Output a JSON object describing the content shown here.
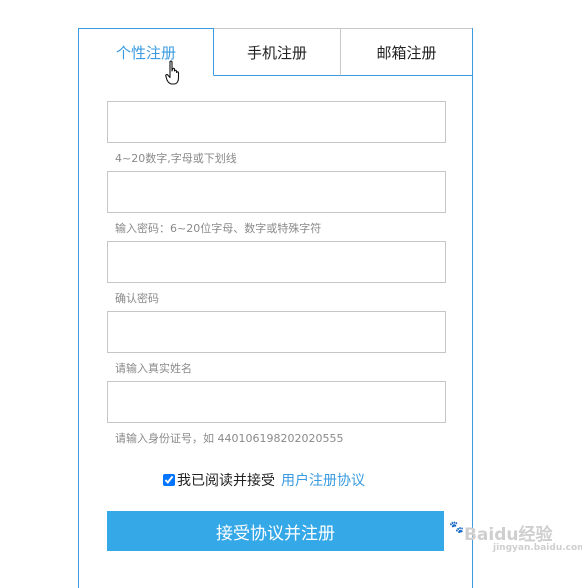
{
  "tabs": [
    {
      "label": "个性注册",
      "active": true
    },
    {
      "label": "手机注册",
      "active": false
    },
    {
      "label": "邮箱注册",
      "active": false
    }
  ],
  "fields": [
    {
      "value": "",
      "hint": "4~20数字,字母或下划线"
    },
    {
      "value": "",
      "hint": "输入密码：6~20位字母、数字或特殊字符"
    },
    {
      "value": "",
      "hint": "确认密码"
    },
    {
      "value": "",
      "hint": "请输入真实姓名"
    },
    {
      "value": "",
      "hint": "请输入身份证号，如 440106198202020555"
    }
  ],
  "agreement": {
    "checked": true,
    "text": "我已阅读并接受",
    "link": "用户注册协议"
  },
  "submit_label": "接受协议并注册",
  "watermark": {
    "brand": "Baidu",
    "suffix": "经验",
    "sub": "jingyan.baidu.com"
  },
  "colors": {
    "accent": "#3a9be0",
    "button": "#35a8e8"
  },
  "icons": {
    "cursor": "hand-pointer-icon",
    "logo": "baidu-paw-icon"
  }
}
